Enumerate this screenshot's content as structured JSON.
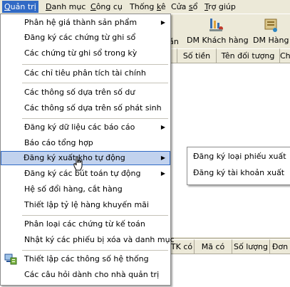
{
  "menubar": {
    "items": [
      {
        "label": "Quản trị",
        "u": "Q",
        "rest": "uản trị"
      },
      {
        "label": "Danh mục",
        "u": "D",
        "rest": "anh mục"
      },
      {
        "label": "Công cụ",
        "u": "C",
        "rest": "ông cụ"
      },
      {
        "label": "Thống kê",
        "pre": "Thống ",
        "u": "k",
        "rest": "ê"
      },
      {
        "label": "Cửa sổ",
        "pre": "Cửa ",
        "u": "s",
        "rest": "ổ"
      },
      {
        "label": "Trợ giúp",
        "u": "T",
        "rest": "rợ giúp"
      }
    ]
  },
  "toolbar": {
    "partial_label": "ần",
    "customers_label": "DM Khách hàng",
    "goods_label": "DM Hàng h"
  },
  "grid_top": {
    "headers": [
      "Số tiền",
      "Tên đối tượng",
      "Ch"
    ]
  },
  "grid_bottom": {
    "headers": [
      "TK có",
      "Mã có",
      "Số lượng",
      "Đơn"
    ]
  },
  "menu": {
    "items": [
      {
        "label": "Phân hệ giá thành sản phẩm",
        "arrow": true
      },
      {
        "label": "Đăng ký các chứng từ ghi sổ"
      },
      {
        "label": "Các chứng từ ghi sổ trong kỳ"
      },
      {
        "label": "Các chỉ tiêu phân tích tài chính"
      },
      {
        "label": "Các thông số dựa trên số dư"
      },
      {
        "label": "Các thông số dựa trên số phát sinh"
      },
      {
        "label": "Đăng ký dữ liệu các báo cáo",
        "arrow": true
      },
      {
        "label": "Báo cáo tổng hợp"
      },
      {
        "label": "Đăng ký xuất kho tự động",
        "arrow": true,
        "highlighted": true
      },
      {
        "label": "Đăng ký các bút toán tự động",
        "arrow": true
      },
      {
        "label": "Hệ số đổi hàng, cắt hàng"
      },
      {
        "label": "Thiết lập tỷ lệ hàng khuyến mãi"
      },
      {
        "label": "Phân loại các chứng từ kế toán"
      },
      {
        "label": "Nhật ký các phiếu bị xóa và danh mục"
      },
      {
        "label": "Thiết lập các thông số hệ thống"
      },
      {
        "label": "Các câu hỏi dành cho nhà quản trị"
      }
    ]
  },
  "submenu": {
    "items": [
      {
        "label": "Đăng ký loại phiếu xuất"
      },
      {
        "label": "Đăng ký tài khoản xuất"
      }
    ]
  },
  "colors": {
    "highlight_bg": "#c1d2ee",
    "highlight_border": "#316ac5",
    "chrome": "#ece9d8"
  }
}
